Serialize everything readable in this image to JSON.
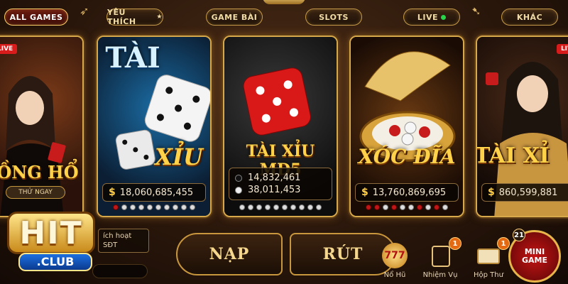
{
  "nav": {
    "items": [
      {
        "label": "ALL GAMES",
        "active": true
      },
      {
        "label": "YÊU THÍCH",
        "star": "★"
      },
      {
        "label": "GAME BÀI"
      },
      {
        "label": "SLOTS"
      },
      {
        "label": "LIVE"
      },
      {
        "label": "KHÁC"
      }
    ]
  },
  "cards": [
    {
      "title": "ỒNG HỔ",
      "button": "THỬ NGAY",
      "live_tag": "LIVE",
      "accent": "#ffd24a"
    },
    {
      "title_top": "TÀI",
      "title_bottom": "XỈU",
      "amount": "18,060,685,455",
      "currency": "$",
      "accent": "#7fd3ff"
    },
    {
      "title": "TÀI XỈU MD5",
      "lines": [
        {
          "icon": "black-dot",
          "value": "14,832,461"
        },
        {
          "icon": "white-dot",
          "value": "38,011,453"
        }
      ]
    },
    {
      "title": "XÓC ĐĨA",
      "amount": "13,760,869,695",
      "currency": "$"
    },
    {
      "title": "TÀI XỈ",
      "amount": "860,599,881",
      "currency": "$",
      "live_tag": "LIV"
    }
  ],
  "bottom": {
    "activate_text_1": "ích hoạt",
    "activate_text_2": "SĐT",
    "nap_label": "NẠP",
    "rut_label": "RÚT",
    "icons": [
      {
        "name": "no-hu",
        "label": "Nổ Hũ",
        "glyph": "777"
      },
      {
        "name": "nhiem-vu",
        "label": "Nhiệm Vụ",
        "badge": "1"
      },
      {
        "name": "hop-thu",
        "label": "Hộp Thư",
        "badge": "1"
      },
      {
        "name": "mini-game",
        "label": "MINI GAME",
        "badge": "21"
      }
    ]
  },
  "logo": {
    "hit": "HIT",
    "club": ".CLUB"
  },
  "colors": {
    "gold": "#d8a94a",
    "red": "#c01818",
    "live_green": "#27d44a"
  }
}
